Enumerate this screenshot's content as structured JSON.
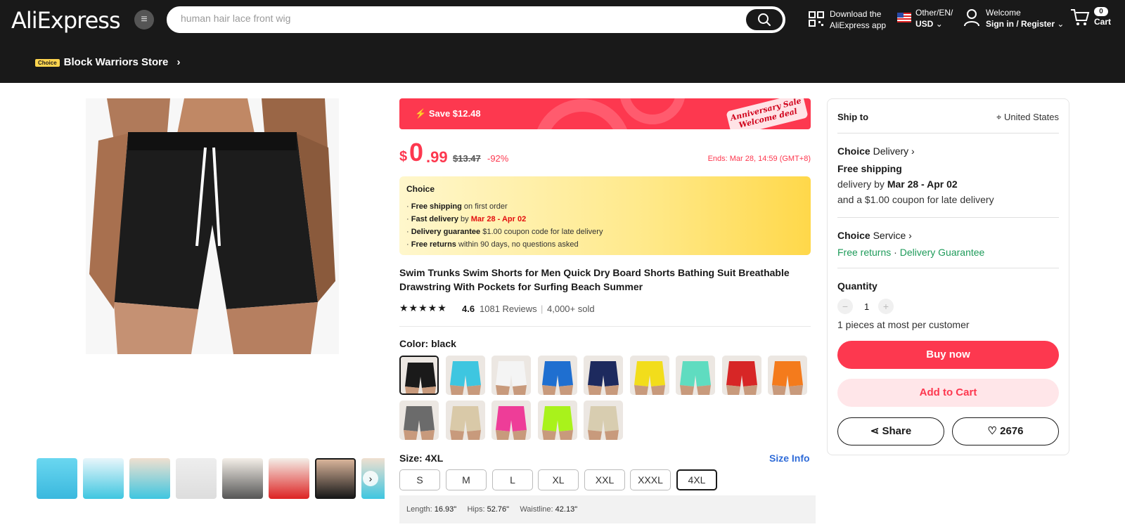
{
  "header": {
    "logo": "AliExpress",
    "search_placeholder": "human hair lace front wig",
    "download_line1": "Download the",
    "download_line2": "AliExpress app",
    "region_line1": "Other/EN/",
    "region_line2": "USD",
    "welcome": "Welcome",
    "sign_in": "Sign in / Register",
    "cart_count": "0",
    "cart_label": "Cart"
  },
  "store": {
    "badge": "Choice",
    "name": "Block Warriors Store"
  },
  "promo": {
    "save": "Save $12.48",
    "tag_line1": "Anniversary Sale",
    "tag_line2": "Welcome deal"
  },
  "price": {
    "currency": "$",
    "whole": "0",
    "cents": ".99",
    "original": "$13.47",
    "discount": "-92%",
    "ends": "Ends: Mar 28, 14:59 (GMT+8)"
  },
  "choice_box": {
    "title": "Choice",
    "items": [
      {
        "bold": "Free shipping",
        "text": " on first order"
      },
      {
        "bold": "Fast delivery",
        "text": " by ",
        "red": "Mar 28 - Apr 02"
      },
      {
        "bold": "Delivery guarantee",
        "text": "  $1.00 coupon code for late delivery"
      },
      {
        "bold": "Free returns",
        "text": "  within 90 days, no questions asked"
      }
    ]
  },
  "product": {
    "title": "Swim Trunks Swim Shorts for Men Quick Dry Board Shorts Bathing Suit Breathable Drawstring With Pockets for Surfing Beach Summer",
    "rating": "4.6",
    "reviews": "1081 Reviews",
    "sold": "4,000+ sold"
  },
  "color": {
    "label": "Color: black",
    "swatches": [
      "#1a1a1a",
      "#3ec6e0",
      "#f4f4f4",
      "#1f6fd0",
      "#1d2a5e",
      "#f2dd1b",
      "#5fdcc0",
      "#d72626",
      "#f47b1c",
      "#6b6b6b",
      "#d9c9a8",
      "#ee3d98",
      "#a9f21b",
      "#d8cdb0"
    ]
  },
  "size": {
    "label": "Size: 4XL",
    "info": "Size Info",
    "options": [
      "S",
      "M",
      "L",
      "XL",
      "XXL",
      "XXXL",
      "4XL"
    ],
    "selected": "4XL",
    "measure": {
      "length_label": "Length:",
      "length": "16.93\"",
      "hips_label": "Hips:",
      "hips": "52.76\"",
      "waist_label": "Waistline:",
      "waist": "42.13\""
    }
  },
  "panel": {
    "ship_to": "Ship to",
    "country": "United States",
    "delivery_choice": "Choice",
    "delivery_title": "Delivery",
    "free_shipping": "Free shipping",
    "delivery_prefix": "delivery by ",
    "delivery_dates": "Mar 28 - Apr 02",
    "coupon_note": "and a $1.00 coupon for late delivery",
    "service_choice": "Choice",
    "service_title": "Service",
    "free_returns": "Free returns",
    "dot": "·",
    "delivery_guarantee": "Delivery Guarantee",
    "quantity_label": "Quantity",
    "quantity": "1",
    "limit_note": "1 pieces at most per customer",
    "buy_now": "Buy now",
    "add_to_cart": "Add to Cart",
    "share": "Share",
    "wishlist_count": "2676"
  },
  "colors": {
    "accent": "#fd384f",
    "dark": "#191919",
    "green": "#1e9b5a",
    "link": "#2e6bd8"
  }
}
